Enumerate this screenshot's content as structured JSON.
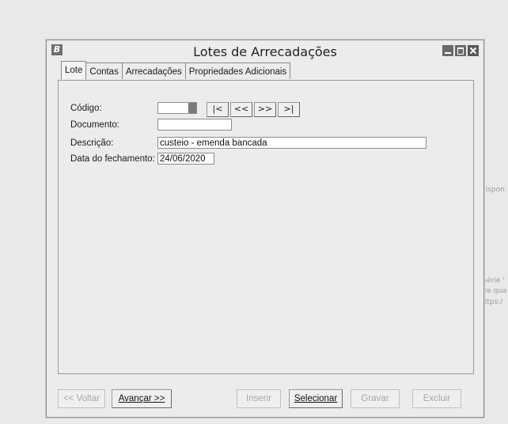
{
  "window": {
    "title": "Lotes de Arrecadações",
    "logo_letter": "B"
  },
  "tabs": [
    {
      "label": "Lote",
      "active": true
    },
    {
      "label": "Contas",
      "active": false
    },
    {
      "label": "Arrecadações",
      "active": false
    },
    {
      "label": "Propriedades Adicionais",
      "active": false
    }
  ],
  "form": {
    "codigo_label": "Código:",
    "codigo_value": "",
    "documento_label": "Documento:",
    "documento_value": "",
    "descricao_label": "Descrição:",
    "descricao_value": "custeio - emenda bancada",
    "data_label": "Data do fechamento:",
    "data_value": "24/06/2020"
  },
  "navigation": {
    "first": "|<",
    "prev": "<<",
    "next": ">>",
    "last": ">|"
  },
  "buttons": {
    "voltar": "<< Voltar",
    "avancar": "Avançar >>",
    "inserir": "Inserir",
    "selecionar": "Selecionar",
    "gravar": "Gravar",
    "excluir": "Excluir"
  },
  "background_text": {
    "line1": "dispon",
    "line2": "a série '",
    "line3": "bre qua",
    "line4": "https:/"
  }
}
